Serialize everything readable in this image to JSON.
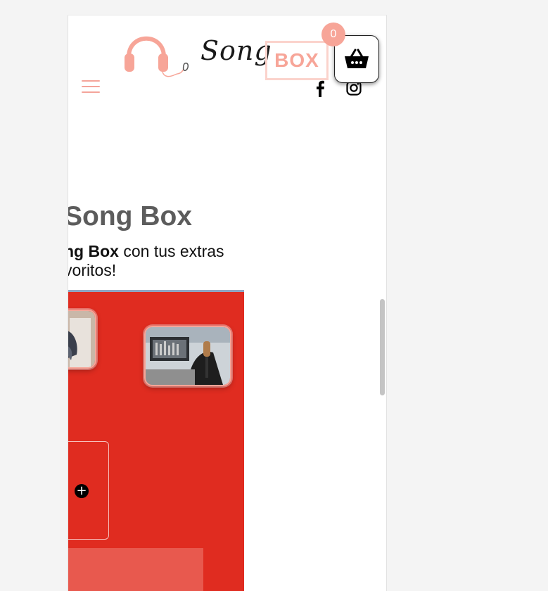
{
  "header": {
    "logo_script": "Song",
    "logo_box": "BOX",
    "cart_count": "0"
  },
  "hero": {
    "headline": "Song Box",
    "subtitle_bold": "ng Box",
    "subtitle_line1_rest": " con tus extras",
    "subtitle_line2": "voritos!"
  },
  "colors": {
    "accent_pink": "#f7a598",
    "hero_red": "#e02c20",
    "heading_gray": "#5c5c5c"
  },
  "icons": [
    "hamburger-menu-icon",
    "headphones-icon",
    "facebook-icon",
    "instagram-icon",
    "basket-icon",
    "plus-icon"
  ]
}
